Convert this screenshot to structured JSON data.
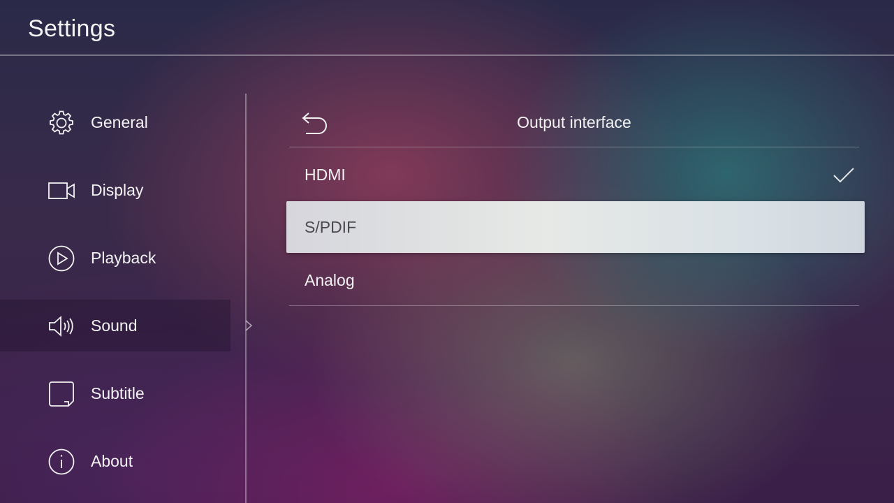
{
  "header": {
    "title": "Settings"
  },
  "sidebar": {
    "items": [
      {
        "label": "General",
        "icon": "gear-icon"
      },
      {
        "label": "Display",
        "icon": "camera-icon"
      },
      {
        "label": "Playback",
        "icon": "play-icon"
      },
      {
        "label": "Sound",
        "icon": "speaker-icon",
        "active": true
      },
      {
        "label": "Subtitle",
        "icon": "subtitle-icon"
      },
      {
        "label": "About",
        "icon": "info-icon"
      }
    ]
  },
  "panel": {
    "title": "Output interface",
    "back_icon": "back-arrow-icon",
    "options": [
      {
        "label": "HDMI",
        "selected": true
      },
      {
        "label": "S/PDIF",
        "focused": true
      },
      {
        "label": "Analog"
      }
    ],
    "check_icon": "checkmark-icon"
  },
  "colors": {
    "focus_bg": "#e2e5e4",
    "focus_text": "#4a4a50",
    "text": "#f2f2f2",
    "divider": "rgba(255,255,255,0.35)"
  }
}
